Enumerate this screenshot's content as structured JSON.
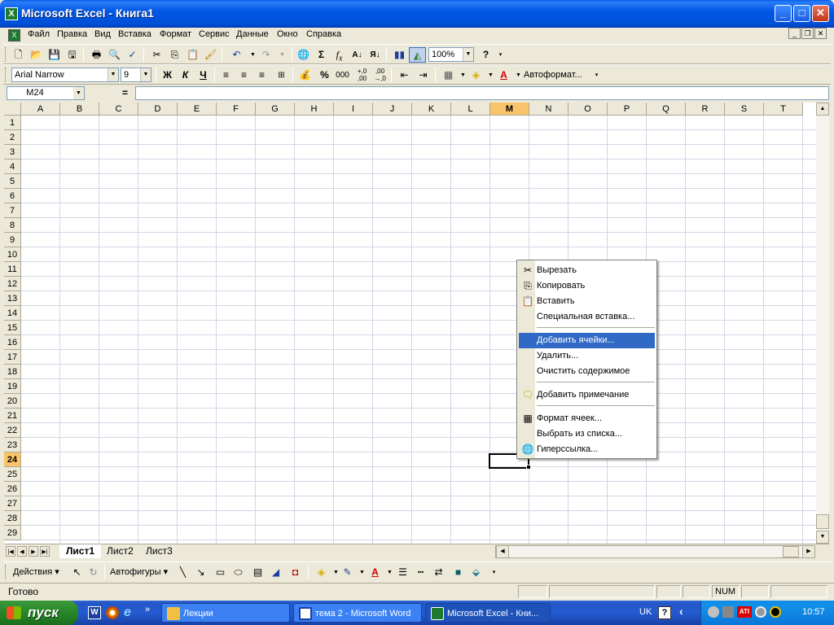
{
  "window": {
    "title": "Microsoft Excel - Книга1",
    "app_icon": "excel-icon"
  },
  "menu": {
    "items": [
      "Файл",
      "Правка",
      "Вид",
      "Вставка",
      "Формат",
      "Сервис",
      "Данные",
      "Окно",
      "Справка"
    ]
  },
  "standard_toolbar": {
    "zoom": "100%"
  },
  "formatting_toolbar": {
    "font": "Arial Narrow",
    "size": "9",
    "bold": "Ж",
    "italic": "К",
    "underline": "Ч",
    "percent": "%",
    "thousands": "000",
    "inc_decimal": "←,0 ,00",
    "autoformat": "Автоформат..."
  },
  "formula_bar": {
    "cell_ref": "M24",
    "equals": "=",
    "value": ""
  },
  "grid": {
    "columns": [
      "A",
      "B",
      "C",
      "D",
      "E",
      "F",
      "G",
      "H",
      "I",
      "J",
      "K",
      "L",
      "M",
      "N",
      "O",
      "P",
      "Q",
      "R",
      "S",
      "T"
    ],
    "rows": [
      "1",
      "2",
      "3",
      "4",
      "5",
      "6",
      "7",
      "8",
      "9",
      "10",
      "11",
      "12",
      "13",
      "14",
      "15",
      "16",
      "17",
      "18",
      "19",
      "20",
      "21",
      "22",
      "23",
      "24",
      "25",
      "26",
      "27",
      "28",
      "29"
    ],
    "active_column": "M",
    "active_row": "24"
  },
  "sheets": {
    "tabs": [
      "Лист1",
      "Лист2",
      "Лист3"
    ],
    "active": "Лист1"
  },
  "drawing_toolbar": {
    "actions": "Действия",
    "autoshapes": "Автофигуры"
  },
  "status": {
    "text": "Готово",
    "num": "NUM"
  },
  "context_menu": {
    "items": [
      {
        "label": "Вырезать",
        "icon": "scissors-icon"
      },
      {
        "label": "Копировать",
        "icon": "copy-icon"
      },
      {
        "label": "Вставить",
        "icon": "paste-icon"
      },
      {
        "label": "Специальная вставка...",
        "icon": ""
      },
      {
        "label": "Добавить ячейки...",
        "icon": "",
        "highlighted": true
      },
      {
        "label": "Удалить...",
        "icon": ""
      },
      {
        "label": "Очистить содержимое",
        "icon": ""
      },
      {
        "label": "Добавить примечание",
        "icon": "comment-icon"
      },
      {
        "label": "Формат ячеек...",
        "icon": "format-cells-icon"
      },
      {
        "label": "Выбрать из списка...",
        "icon": ""
      },
      {
        "label": "Гиперссылка...",
        "icon": "hyperlink-icon"
      }
    ]
  },
  "taskbar": {
    "start": "пуск",
    "buttons": [
      {
        "label": "Лекции",
        "icon": "folder-icon"
      },
      {
        "label": "тема 2 - Microsoft Word",
        "icon": "word-icon"
      },
      {
        "label": "Microsoft Excel - Кни...",
        "icon": "excel-icon",
        "active": true
      }
    ],
    "lang": "UK",
    "clock": "10:57"
  },
  "colors": {
    "accent": "#316ac5",
    "titlebar": "#0058e6",
    "taskbar": "#245bd0",
    "start": "#2a8a2a"
  }
}
